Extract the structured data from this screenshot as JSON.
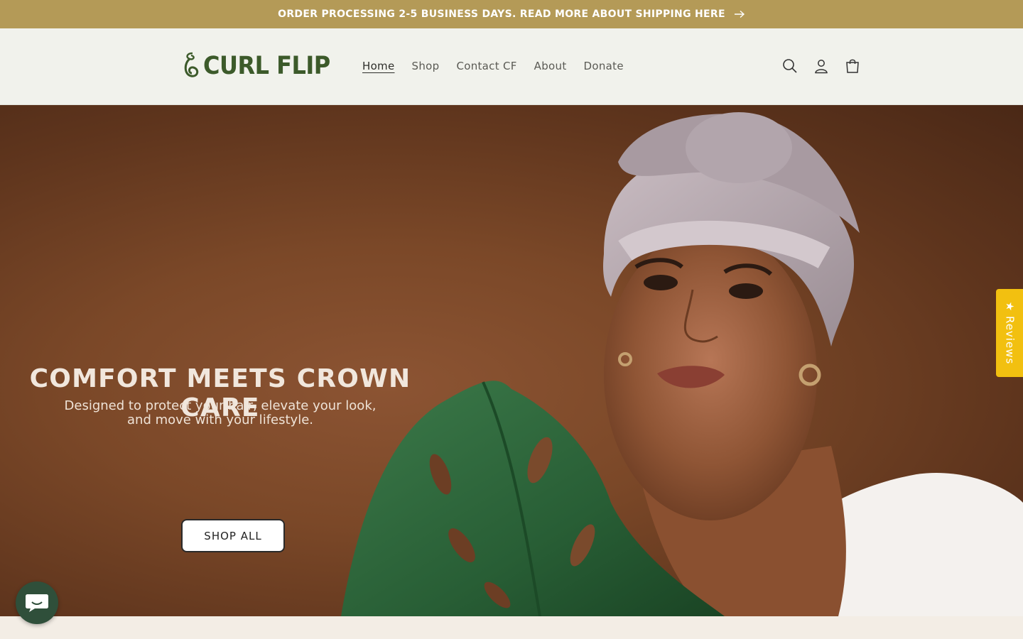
{
  "announcement": {
    "text": "ORDER PROCESSING 2-5 BUSINESS DAYS. READ MORE ABOUT SHIPPING HERE"
  },
  "header": {
    "logo_text": "CURL FLIP",
    "nav": [
      {
        "label": "Home",
        "active": true
      },
      {
        "label": "Shop"
      },
      {
        "label": "Contact CF"
      },
      {
        "label": "About"
      },
      {
        "label": "Donate"
      }
    ],
    "icons": [
      "search-icon",
      "account-icon",
      "cart-icon"
    ]
  },
  "hero": {
    "title": "COMFORT MEETS CROWN CARE",
    "subtitle_line1": "Designed to protect your hair, elevate your look,",
    "subtitle_line2": "and move with your lifestyle.",
    "button_label": "SHOP ALL"
  },
  "reviews_tab": {
    "star": "★",
    "label": "Reviews"
  },
  "colors": {
    "announcement_bg": "#b49a57",
    "header_bg": "#f1f2ec",
    "brand_green": "#3c5a2a",
    "hero_bg": "#7b4828",
    "reviews_tab_bg": "#f2c010",
    "chat_bg": "#2f4f3a"
  }
}
